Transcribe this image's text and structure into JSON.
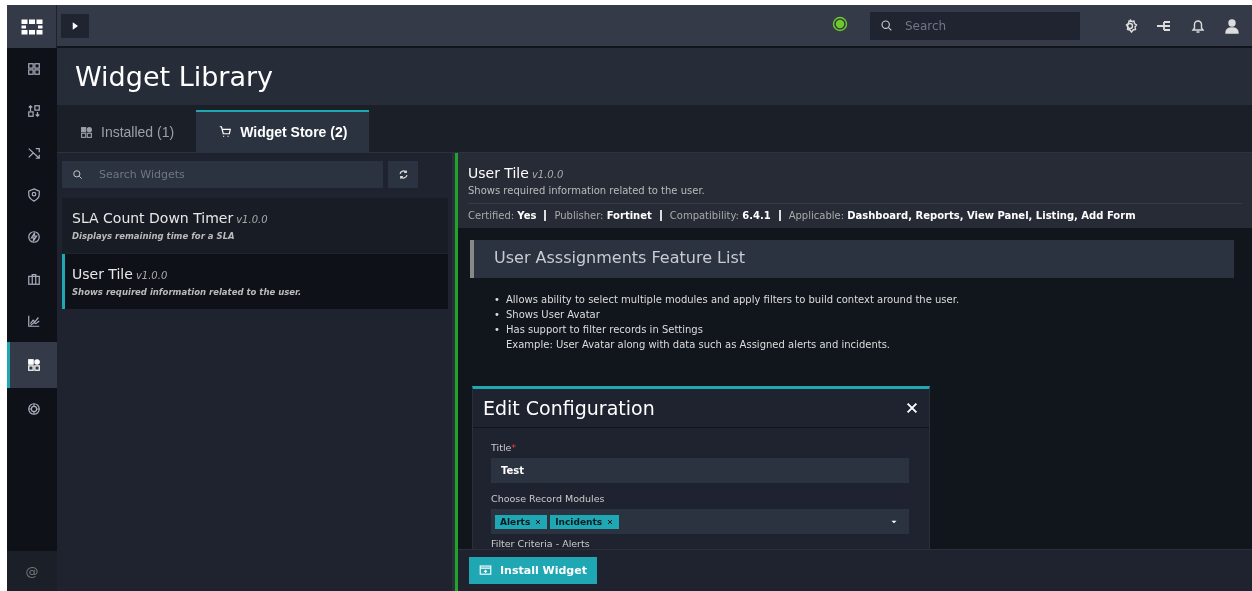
{
  "topbar": {
    "search": {
      "placeholder": "Search"
    }
  },
  "sidebar": {
    "items": [
      {
        "selected": false
      },
      {
        "selected": false
      },
      {
        "selected": false
      },
      {
        "selected": false
      },
      {
        "selected": false
      },
      {
        "selected": false
      },
      {
        "selected": false
      },
      {
        "selected": true
      },
      {
        "selected": false
      }
    ],
    "footer": "@"
  },
  "page_title": "Widget Library",
  "tabs": [
    {
      "label": "Installed (1)",
      "selected": false
    },
    {
      "label": "Widget Store (2)",
      "selected": true
    }
  ],
  "widget_search": {
    "placeholder": "Search Widgets"
  },
  "widgets": [
    {
      "name": "SLA Count Down Timer",
      "version": "v1.0.0",
      "description": "Displays remaining time for a SLA",
      "selected": false
    },
    {
      "name": "User Tile",
      "version": "v1.0.0",
      "description": "Shows required information related to the user.",
      "selected": true
    }
  ],
  "detail": {
    "name": "User Tile",
    "version": "v1.0.0",
    "description": "Shows required information related to the user.",
    "meta": [
      {
        "label": "Certified:",
        "value": "Yes"
      },
      {
        "label": "Publisher:",
        "value": "Fortinet"
      },
      {
        "label": "Compatibility:",
        "value": "6.4.1"
      },
      {
        "label": "Applicable:",
        "value": "Dashboard, Reports, View Panel, Listing, Add Form"
      }
    ],
    "feature_heading": "User Asssignments Feature List",
    "features": [
      {
        "bullet": "•",
        "text": "Allows ability to select multiple modules and apply filters to build context around the user."
      },
      {
        "bullet": "•",
        "text": "Shows User Avatar"
      },
      {
        "bullet": "•",
        "text": "Has support to filter records in Settings",
        "note": "Example: User Avatar along with data such as Assigned alerts and incidents."
      }
    ]
  },
  "modal": {
    "title": "Edit Configuration",
    "fields": [
      {
        "kind": "text",
        "label": "Title",
        "required_mark": "*",
        "value": "Test"
      },
      {
        "kind": "tags",
        "label": "Choose Record Modules",
        "tags": [
          "Alerts",
          "Incidents"
        ]
      },
      {
        "kind": "heading",
        "label": "Filter Criteria - Alerts"
      }
    ]
  },
  "install_button": "Install Widget"
}
